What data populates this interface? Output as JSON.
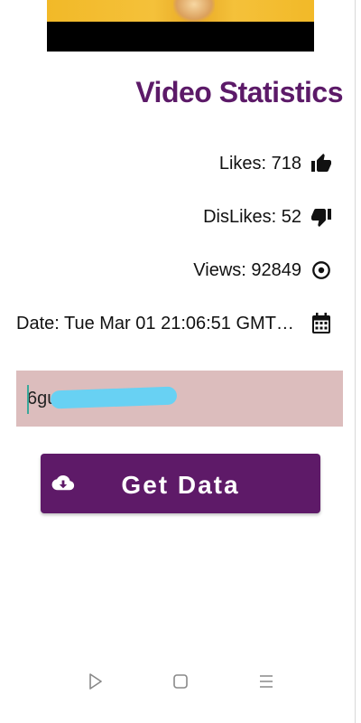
{
  "page": {
    "title": "Video Statistics"
  },
  "stats": {
    "likes": "Likes: 718",
    "dislikes": "DisLikes: 52",
    "views": "Views: 92849",
    "date": "Date: Tue Mar 01 21:06:51 GMT+..."
  },
  "search": {
    "value": "6gu"
  },
  "button": {
    "label": "Get Data"
  },
  "icons": {
    "likes": "thumbs-up-icon",
    "dislikes": "thumbs-down-icon",
    "views": "eye-icon",
    "date": "calendar-icon",
    "button": "cloud-download-icon"
  },
  "colors": {
    "accent": "#5c1a68",
    "input_bg": "#dcbdbd",
    "button_bg": "#5e1a68"
  }
}
